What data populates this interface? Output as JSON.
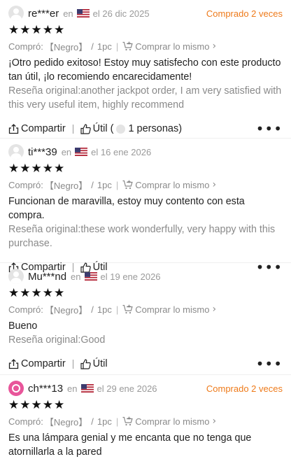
{
  "reviews": [
    {
      "user": "re***er",
      "in_label": "en",
      "date": "el 26 dic 2025",
      "bought_badge": "Comprado 2 veces",
      "rating": 5,
      "bought_label": "Compró:",
      "variant": "【Negro】",
      "qty": "1pc",
      "buy_same": "Comprar lo mismo",
      "text": "¡Otro pedido exitoso! Estoy muy satisfecho con este producto tan útil, ¡lo recomiendo encarecidamente!",
      "original": "Reseña original:another jackpot order, I am very satisfied with this very useful item, highly recommend",
      "share_label": "Compartir",
      "helpful_label": "Útil",
      "helpful_open": "(",
      "helpful_count": "1 personas)"
    },
    {
      "user": "ti***39",
      "in_label": "en",
      "date": "el 16 ene 2026",
      "bought_badge": "",
      "rating": 5,
      "bought_label": "Compró:",
      "variant": "【Negro】",
      "qty": "1pc",
      "buy_same": "Comprar lo mismo",
      "text": "Funcionan de maravilla, estoy muy contento con esta compra.",
      "original": "Reseña original:these work wonderfully, very happy with this purchase.",
      "share_label": "Compartir",
      "helpful_label": "Útil"
    },
    {
      "user": "Mu***nd",
      "in_label": "en",
      "date": "el 19 ene 2026",
      "bought_badge": "",
      "rating": 5,
      "bought_label": "Compró:",
      "variant": "【Negro】",
      "qty": "1pc",
      "buy_same": "Comprar lo mismo",
      "text": "Bueno",
      "original": "Reseña original:Good",
      "share_label": "Compartir",
      "helpful_label": "Útil"
    },
    {
      "user": "ch***13",
      "in_label": "en",
      "date": "el 29 ene 2026",
      "bought_badge": "Comprado 2 veces",
      "rating": 5,
      "bought_label": "Compró:",
      "variant": "【Negro】",
      "qty": "1pc",
      "buy_same": "Comprar lo mismo",
      "text": "Es una lámpara genial y me encanta que no tenga que atornillarla a la pared"
    }
  ],
  "icons": {
    "avatar": "default-avatar-icon",
    "avatar_alt": "pink-ring-avatar-icon",
    "flag": "us-flag-icon",
    "star": "star-icon",
    "cart": "cart-icon",
    "chevron": "chevron-right-icon",
    "share": "share-icon",
    "helpful": "thumbs-up-icon",
    "more": "more-dots-icon"
  },
  "colors": {
    "badge": "#ee7a1a",
    "muted": "#8a8a8a",
    "text": "#222222",
    "avatar_alt": "#e8559a"
  }
}
